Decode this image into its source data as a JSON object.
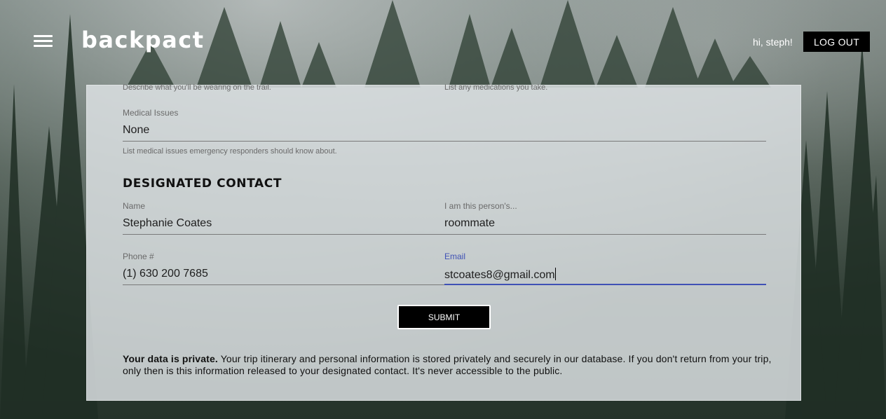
{
  "header": {
    "brand": "backpact",
    "greeting": "hi, steph!",
    "logout_label": "LOG OUT"
  },
  "form": {
    "clothing_helper": "Describe what you'll be wearing on the trail.",
    "medications_helper": "List any medications you take.",
    "medical": {
      "label": "Medical Issues",
      "value": "None",
      "helper": "List medical issues emergency responders should know about."
    },
    "contact_section_title": "DESIGNATED CONTACT",
    "contact_name": {
      "label": "Name",
      "value": "Stephanie Coates"
    },
    "relationship": {
      "label": "I am this person's...",
      "value": "roommate"
    },
    "phone": {
      "label": "Phone #",
      "value": "(1) 630 200 7685"
    },
    "email": {
      "label": "Email",
      "value": "stcoates8@gmail.com"
    },
    "submit_label": "SUBMIT"
  },
  "privacy": {
    "bold": "Your data is private.",
    "text": " Your trip itinerary and personal information is stored privately and securely in our database. If you don't return from your trip, only then is this information released to your designated contact. It's never accessible to the public."
  }
}
